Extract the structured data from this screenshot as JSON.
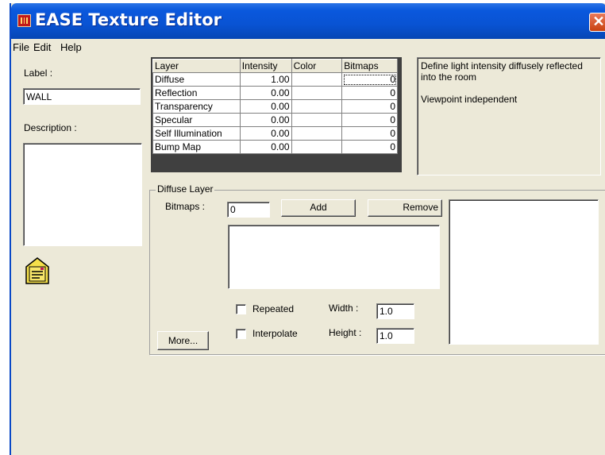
{
  "window": {
    "title": "EASE Texture Editor",
    "close_glyph": "✕"
  },
  "menu": [
    "File",
    "Edit",
    "Help"
  ],
  "left": {
    "label_caption": "Label :",
    "label_value": "WALL",
    "description_caption": "Description :",
    "description_value": ""
  },
  "grid": {
    "headers": [
      "Layer",
      "Intensity",
      "Color",
      "Bitmaps"
    ],
    "rows": [
      {
        "layer": "Diffuse",
        "intensity": "1.00",
        "color": "",
        "bitmaps": "0"
      },
      {
        "layer": "Reflection",
        "intensity": "0.00",
        "color": "",
        "bitmaps": "0"
      },
      {
        "layer": "Transparency",
        "intensity": "0.00",
        "color": "",
        "bitmaps": "0"
      },
      {
        "layer": "Specular",
        "intensity": "0.00",
        "color": "",
        "bitmaps": "0"
      },
      {
        "layer": "Self Illumination",
        "intensity": "0.00",
        "color": "",
        "bitmaps": "0"
      },
      {
        "layer": "Bump Map",
        "intensity": "0.00",
        "color": "",
        "bitmaps": "0"
      }
    ]
  },
  "info": {
    "line1": "Define light intensity diffusely reflected",
    "line2": "into the room",
    "line3": "Viewpoint independent"
  },
  "layer_group": {
    "title": "Diffuse Layer",
    "bitmaps_caption": "Bitmaps :",
    "bitmaps_value": "0",
    "add_label": "Add",
    "remove_label": "Remove",
    "repeated_label": "Repeated",
    "interpolate_label": "Interpolate",
    "repeated_checked": false,
    "interpolate_checked": false,
    "width_caption": "Width :",
    "width_value": "1.0",
    "height_caption": "Height :",
    "height_value": "1.0",
    "more_label": "More..."
  },
  "colors": {
    "titlebar": "#0953d3",
    "dialog_bg": "#ece9d8",
    "close": "#c9410f",
    "envelope": "#f5e04a"
  },
  "icons": [
    "app-icon",
    "close-icon",
    "envelope-icon"
  ]
}
